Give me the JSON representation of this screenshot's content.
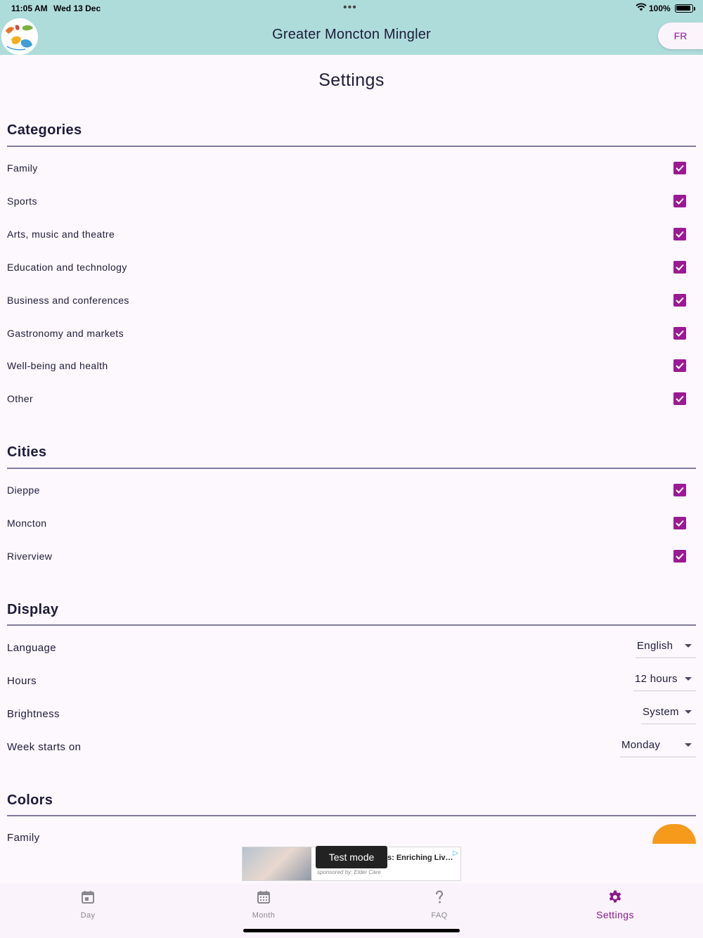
{
  "status_bar": {
    "time": "11:05 AM",
    "date": "Wed 13 Dec",
    "dots": "•••",
    "battery_pct": "100%",
    "battery_level": 1.0
  },
  "app_bar": {
    "title": "Greater Moncton Mingler",
    "lang_button": "FR",
    "logo_icon": "hands-logo-icon"
  },
  "page": {
    "title": "Settings"
  },
  "categories": {
    "title": "Categories",
    "items": [
      {
        "label": "Family",
        "checked": true
      },
      {
        "label": "Sports",
        "checked": true
      },
      {
        "label": "Arts, music and theatre",
        "checked": true
      },
      {
        "label": "Education and technology",
        "checked": true
      },
      {
        "label": "Business and conferences",
        "checked": true
      },
      {
        "label": "Gastronomy and markets",
        "checked": true
      },
      {
        "label": "Well-being and health",
        "checked": true
      },
      {
        "label": "Other",
        "checked": true
      }
    ]
  },
  "cities": {
    "title": "Cities",
    "items": [
      {
        "label": "Dieppe",
        "checked": true
      },
      {
        "label": "Moncton",
        "checked": true
      },
      {
        "label": "Riverview",
        "checked": true
      }
    ]
  },
  "display": {
    "title": "Display",
    "language": {
      "label": "Language",
      "value": "English"
    },
    "hours": {
      "label": "Hours",
      "value": "12 hours"
    },
    "brightness": {
      "label": "Brightness",
      "value": "System"
    },
    "week_start": {
      "label": "Week starts on",
      "value": "Monday"
    }
  },
  "colors": {
    "title": "Colors",
    "family": {
      "label": "Family",
      "color": "#f59a1b"
    }
  },
  "ad": {
    "headline": "s: Enriching Liv…",
    "sponsor": "sponsored by: Elder Care",
    "test_mode": "Test mode",
    "choice_icon": "ad-choices-icon"
  },
  "bottom_nav": {
    "items": [
      {
        "label": "Day",
        "icon": "calendar-day-icon"
      },
      {
        "label": "Month",
        "icon": "calendar-month-icon"
      },
      {
        "label": "FAQ",
        "icon": "question-icon"
      },
      {
        "label": "Settings",
        "icon": "gear-icon",
        "active": true
      }
    ]
  },
  "colors_theme": {
    "accent": "#9a1a94",
    "app_bar": "#aedcdb",
    "background": "#fdf8fd"
  }
}
